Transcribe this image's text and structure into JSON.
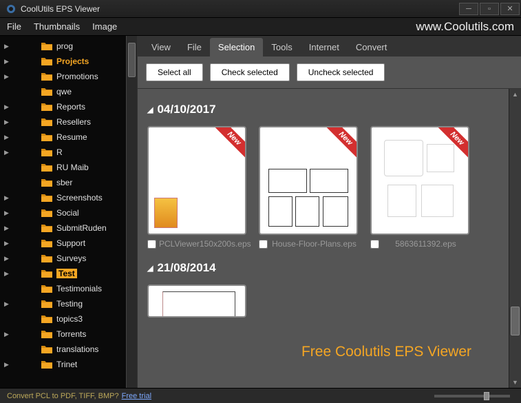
{
  "window": {
    "title": "CoolUtils EPS Viewer"
  },
  "menu": {
    "file": "File",
    "thumbnails": "Thumbnails",
    "image": "Image",
    "url": "www.Coolutils.com"
  },
  "sidebar": {
    "items": [
      {
        "label": "prog",
        "expandable": true
      },
      {
        "label": "Projects",
        "expandable": true,
        "highlight": true
      },
      {
        "label": "Promotions",
        "expandable": true
      },
      {
        "label": "qwe",
        "expandable": false
      },
      {
        "label": "Reports",
        "expandable": true
      },
      {
        "label": "Resellers",
        "expandable": true
      },
      {
        "label": "Resume",
        "expandable": true
      },
      {
        "label": "R",
        "expandable": true
      },
      {
        "label": "RU Maib",
        "expandable": false
      },
      {
        "label": "sber",
        "expandable": false
      },
      {
        "label": "Screenshots",
        "expandable": true
      },
      {
        "label": "Social",
        "expandable": true
      },
      {
        "label": "SubmitRuden",
        "expandable": true
      },
      {
        "label": "Support",
        "expandable": true
      },
      {
        "label": "Surveys",
        "expandable": true
      },
      {
        "label": "Test",
        "expandable": true,
        "selected": true
      },
      {
        "label": "Testimonials",
        "expandable": false
      },
      {
        "label": "Testing",
        "expandable": true
      },
      {
        "label": "topics3",
        "expandable": false
      },
      {
        "label": "Torrents",
        "expandable": true
      },
      {
        "label": "translations",
        "expandable": false
      },
      {
        "label": "Trinet",
        "expandable": true
      }
    ]
  },
  "tabs": {
    "view": "View",
    "file": "File",
    "selection": "Selection",
    "tools": "Tools",
    "internet": "Internet",
    "convert": "Convert"
  },
  "toolbar": {
    "select_all": "Select all",
    "check": "Check selected",
    "uncheck": "Uncheck selected"
  },
  "groups": [
    {
      "date": "04/10/2017",
      "files": [
        {
          "name": "PCLViewer150x200s.eps",
          "ribbon": "New"
        },
        {
          "name": "House-Floor-Plans.eps",
          "ribbon": "New"
        },
        {
          "name": "5863611392.eps",
          "ribbon": "New"
        }
      ]
    },
    {
      "date": "21/08/2014",
      "files": [
        {
          "name": ""
        }
      ]
    }
  ],
  "brand_overlay": "Free Coolutils EPS Viewer",
  "status": {
    "text": "Convert PCL to PDF, TIFF, BMP?",
    "link": "Free trial"
  }
}
